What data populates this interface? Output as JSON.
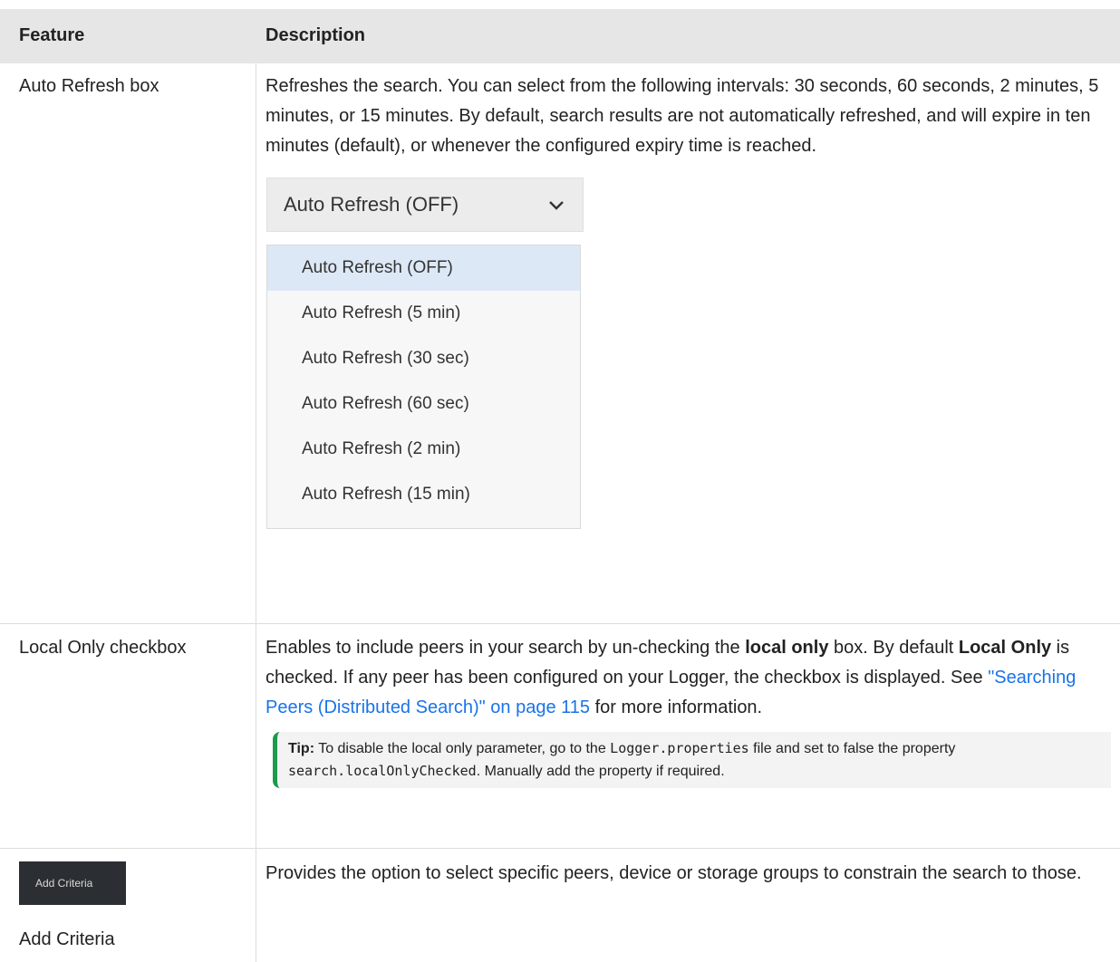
{
  "header": {
    "feature": "Feature",
    "description": "Description"
  },
  "auto_refresh": {
    "feature": "Auto Refresh box",
    "description": "Refreshes the search. You can select from the following intervals: 30 seconds, 60 seconds, 2 minutes, 5 minutes, or 15 minutes. By default, search results are not automatically refreshed, and will expire in ten minutes (default), or whenever the configured expiry time is reached.",
    "dropdown": {
      "selected": "Auto Refresh (OFF)",
      "options": [
        "Auto Refresh (OFF)",
        "Auto Refresh (5 min)",
        "Auto Refresh (30 sec)",
        "Auto Refresh (60 sec)",
        "Auto Refresh (2 min)",
        "Auto Refresh (15 min)"
      ]
    }
  },
  "local_only": {
    "feature": "Local Only checkbox",
    "desc_part1": "Enables to include peers in your search by un-checking the ",
    "desc_bold1": "local only",
    "desc_part2": " box. By default ",
    "desc_bold2": "Local Only",
    "desc_part3": " is checked. If any peer has been configured on your Logger, the checkbox is displayed. See ",
    "desc_link": "\"Searching Peers (Distributed Search)\" on page 115",
    "desc_part4": " for more information.",
    "tip": {
      "label": "Tip:",
      "part1": " To disable the local only parameter, go to the ",
      "code1": "Logger.properties",
      "part2": " file and set to false the property ",
      "code2": "search.localOnlyChecked",
      "part3": ". Manually add the property if required."
    }
  },
  "add_criteria": {
    "button_label": "Add Criteria",
    "feature": "Add Criteria",
    "description": "Provides the option to select specific peers, device or storage groups to constrain the search to those."
  }
}
